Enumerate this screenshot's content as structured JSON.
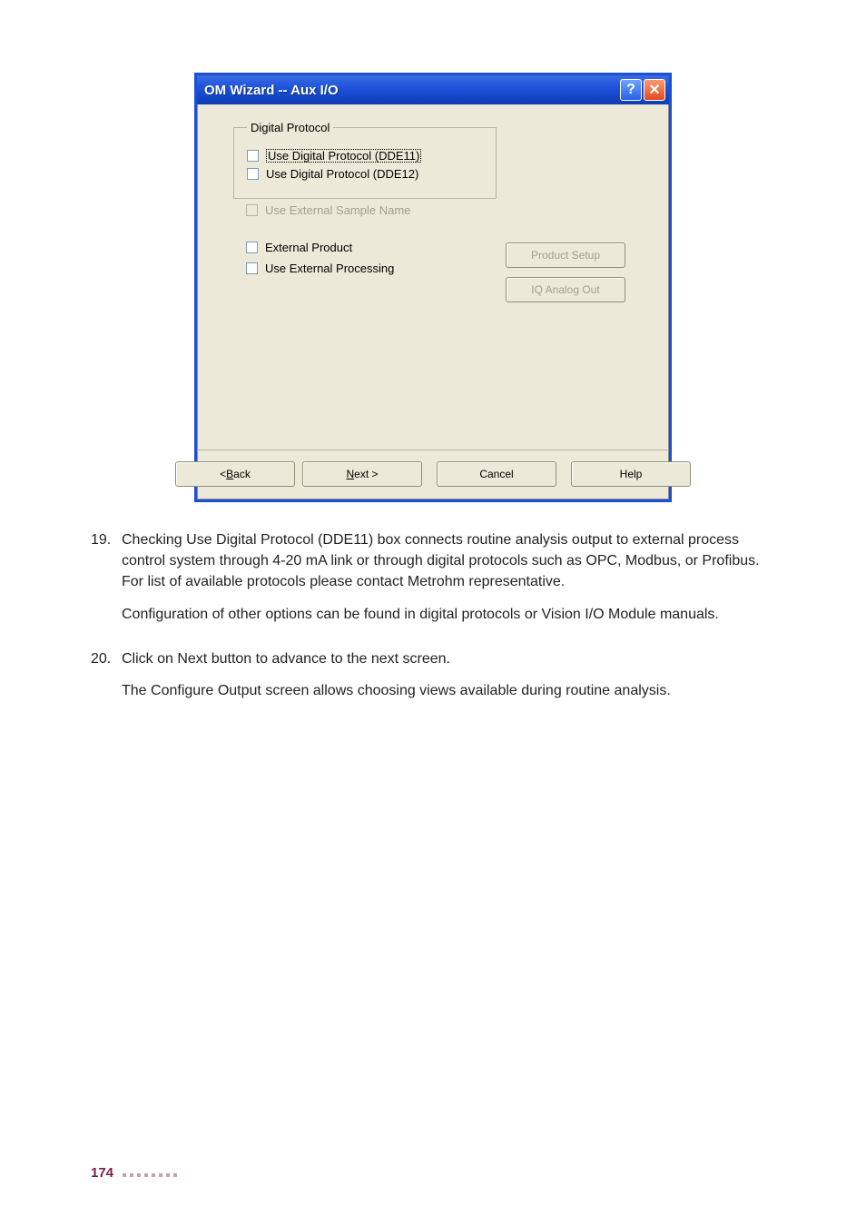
{
  "dialog": {
    "title": "OM Wizard -- Aux I/O",
    "group_legend": "Digital Protocol",
    "chk_dde11": "Use Digital Protocol (DDE11)",
    "chk_dde12": "Use Digital Protocol (DDE12)",
    "chk_ext_sample": "Use External Sample Name",
    "chk_ext_product": "External Product",
    "chk_ext_processing": "Use External Processing",
    "btn_product_setup": "Product Setup",
    "btn_iq_analog": "IQ Analog Out",
    "btn_back_prefix": "< ",
    "btn_back_u": "B",
    "btn_back_rest": "ack",
    "btn_next_u": "N",
    "btn_next_rest": "ext >",
    "btn_cancel": "Cancel",
    "btn_help": "Help"
  },
  "doc": {
    "item19_num": "19.",
    "item19_p1": "Checking Use Digital Protocol (DDE11) box connects routine analysis output to external process control system through 4-20 mA link or through digital protocols such as OPC, Modbus, or Profibus. For list of available protocols please contact Metrohm representative.",
    "item19_p2": "Configuration of other options can be found in digital protocols or Vision I/O Module manuals.",
    "item20_num": "20.",
    "item20_p1": "Click on Next button to advance to the next screen.",
    "item20_p2": "The Configure Output screen allows choosing views available during routine analysis."
  },
  "footer": {
    "page_number": "174"
  }
}
